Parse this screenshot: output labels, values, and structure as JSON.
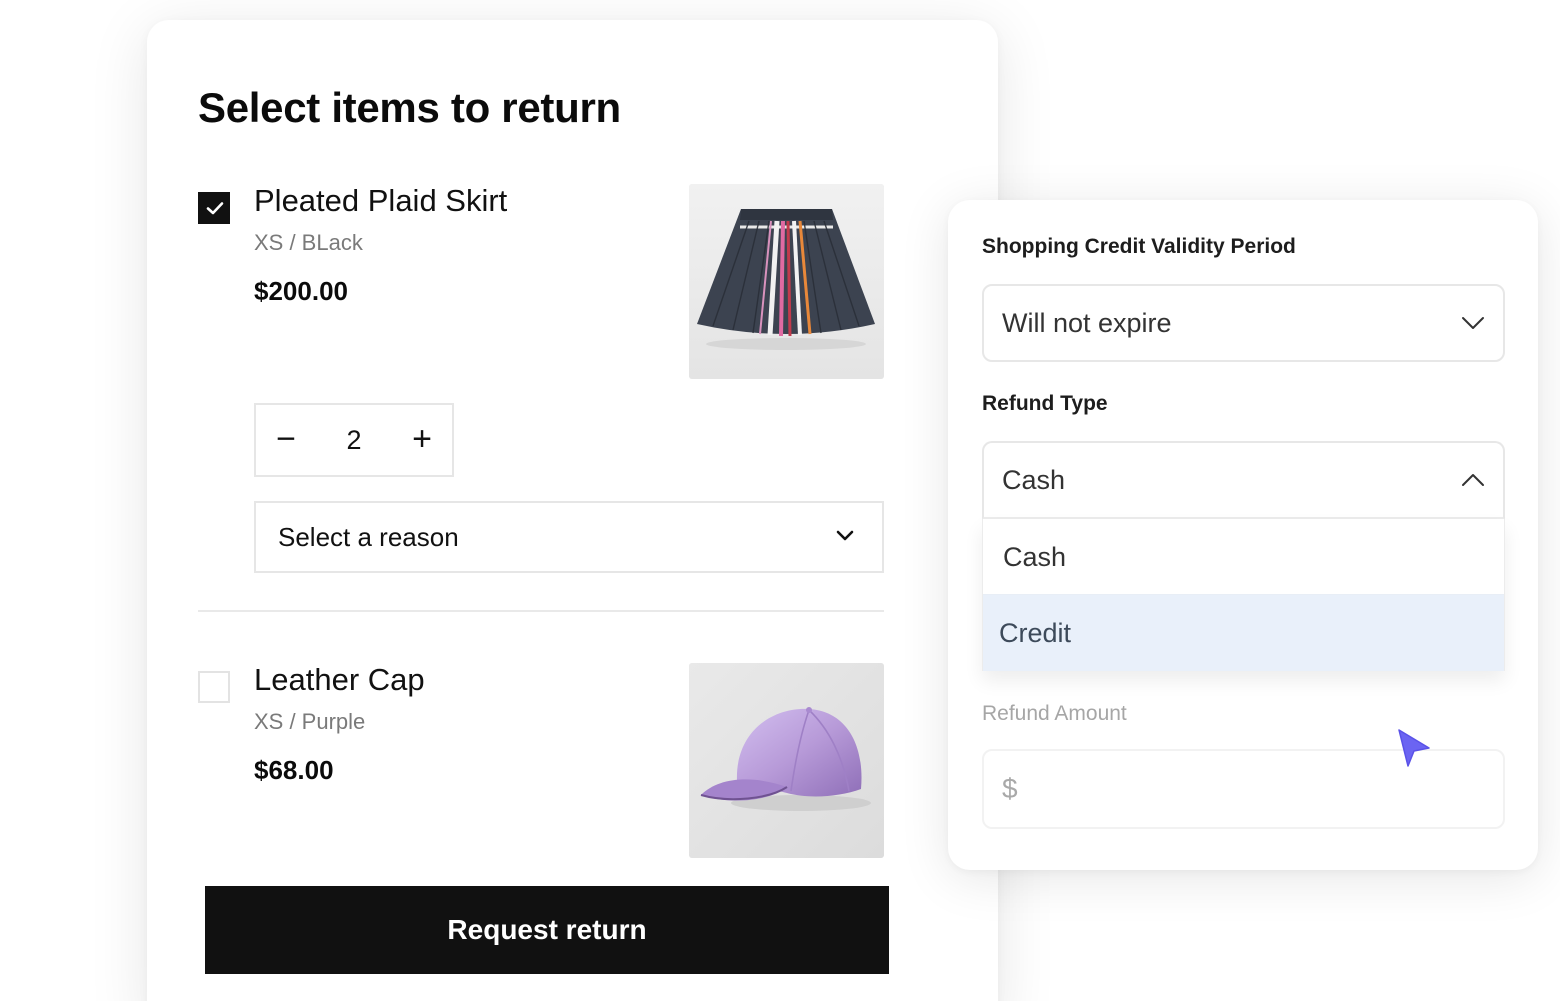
{
  "return_form": {
    "title": "Select items to return",
    "items": [
      {
        "name": "Pleated Plaid Skirt",
        "variant": "XS / BLack",
        "price": "$200.00",
        "checked": true,
        "quantity": "2",
        "minus_label": "−",
        "plus_label": "+",
        "reason_placeholder": "Select a reason"
      },
      {
        "name": "Leather Cap",
        "variant": "XS / Purple",
        "price": "$68.00",
        "checked": false
      }
    ],
    "submit_label": "Request return"
  },
  "refund_panel": {
    "validity_label": "Shopping Credit Validity Period",
    "validity_value": "Will not expire",
    "refund_type_label": "Refund Type",
    "refund_type_value": "Cash",
    "refund_type_options": [
      "Cash",
      "Credit"
    ],
    "refund_amount_label": "Refund Amount",
    "currency_prefix": "$"
  },
  "icons": {
    "checkmark": "check-icon",
    "chevron": "chevron-down-icon",
    "chevron_up": "chevron-up-icon",
    "cursor": "pointer-cursor-icon"
  },
  "colors": {
    "primary": "#111111",
    "dropdown_highlight": "#e9f0fa",
    "cursor": "#6b64f2",
    "cap_purple": "#b79ad8"
  }
}
